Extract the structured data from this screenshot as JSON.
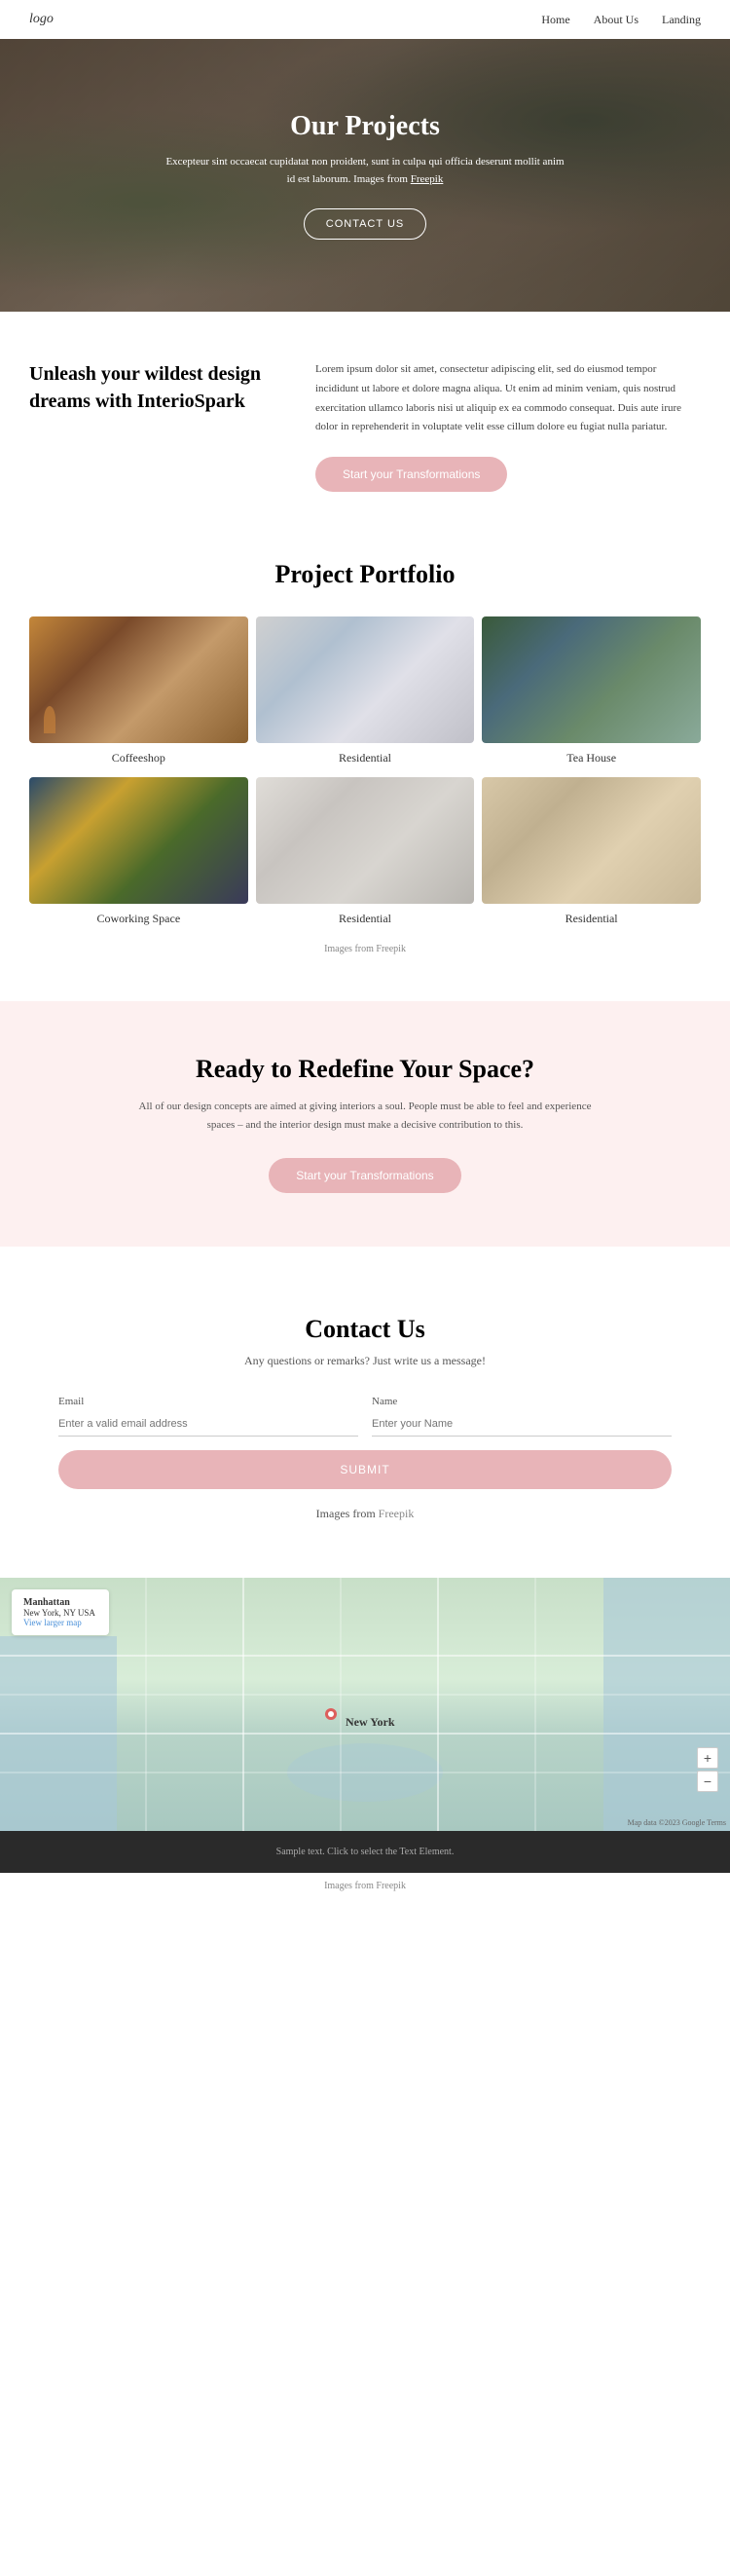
{
  "nav": {
    "logo": "logo",
    "links": [
      "Home",
      "About Us",
      "Landing"
    ]
  },
  "hero": {
    "title": "Our Projects",
    "subtitle": "Excepteur sint occaecat cupidatat non proident, sunt in culpa qui officia deserunt mollit anim id est laborum. Images from",
    "freepik_link": "Freepik",
    "cta_button": "CONTACT US"
  },
  "intro": {
    "heading": "Unleash your wildest design dreams with InterioSpark",
    "body": "Lorem ipsum dolor sit amet, consectetur adipiscing elit, sed do eiusmod tempor incididunt ut labore et dolore magna aliqua. Ut enim ad minim veniam, quis nostrud exercitation ullamco laboris nisi ut aliquip ex ea commodo consequat. Duis aute irure dolor in reprehenderit in voluptate velit esse cillum dolore eu fugiat nulla pariatur.",
    "cta": "Start your Transformations"
  },
  "portfolio": {
    "title": "Project Portfolio",
    "items": [
      {
        "label": "Coffeeshop",
        "img_class": "img-coffeeshop"
      },
      {
        "label": "Residential",
        "img_class": "img-residential1"
      },
      {
        "label": "Tea House",
        "img_class": "img-teahouse"
      },
      {
        "label": "Coworking Space",
        "img_class": "img-coworking"
      },
      {
        "label": "Residential",
        "img_class": "img-residential2"
      },
      {
        "label": "Residential",
        "img_class": "img-residential3"
      }
    ],
    "freepik_note": "Images from",
    "freepik_link": "Freepik"
  },
  "cta_section": {
    "title": "Ready to Redefine Your Space?",
    "body": "All of our design concepts are aimed at giving interiors a soul. People must be able to feel and experience spaces – and the interior design must make a decisive contribution to this.",
    "cta": "Start your Transformations"
  },
  "contact": {
    "title": "Contact Us",
    "subtitle": "Any questions or remarks? Just write us a message!",
    "email_label": "Email",
    "email_placeholder": "Enter a valid email address",
    "name_label": "Name",
    "name_placeholder": "Enter your Name",
    "submit_label": "SUBMIT",
    "freepik_note": "Images from",
    "freepik_link": "Freepik"
  },
  "map": {
    "city_label": "New York",
    "location_name": "Manhattan",
    "location_address": "New York, NY USA",
    "view_larger": "View larger map",
    "zoom_in": "+",
    "zoom_out": "−",
    "attribution": "Map data ©2023 Google  Terms"
  },
  "footer": {
    "text": "Sample text. Click to select the Text Element.",
    "freepik_note": "Images from",
    "freepik_link": "Freepik"
  }
}
